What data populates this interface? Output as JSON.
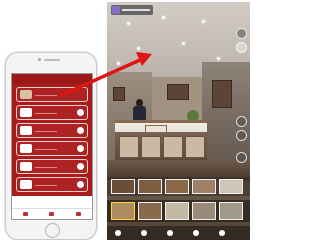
{
  "phone": {
    "screen_title": "",
    "menu_items": [
      {
        "label": "",
        "icon": "photo-icon"
      },
      {
        "label": "",
        "icon": "chat-icon"
      },
      {
        "label": "",
        "icon": "eye-icon"
      },
      {
        "label": "",
        "icon": "camera-icon"
      },
      {
        "label": "",
        "icon": "phone-icon"
      },
      {
        "label": "",
        "icon": "heart-icon"
      }
    ]
  },
  "panorama": {
    "thumbnail_count_top": 5,
    "thumbnail_count_bottom": 5,
    "active_thumbnail": 0
  },
  "colors": {
    "phone_header": "#9a1818",
    "menu_background": "#a81c1c",
    "arrow": "#e01414",
    "active_thumb": "#ffd43a"
  }
}
